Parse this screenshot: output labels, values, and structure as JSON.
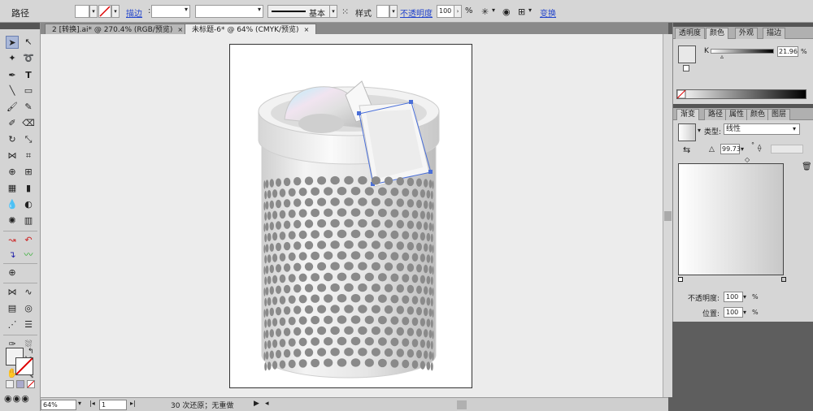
{
  "control_bar": {
    "selection_label": "路径",
    "stroke_label": "描边",
    "stroke_profile": "基本",
    "style_label": "样式",
    "opacity_label": "不透明度",
    "opacity_value": "100",
    "opacity_unit": "%",
    "transform_label": "变换"
  },
  "doc_tabs": [
    {
      "label": "2 [转换].ai* @ 270.4% (RGB/预览)",
      "close": "×"
    },
    {
      "label": "未标题-6* @ 64% (CMYK/预览)",
      "close": "×"
    }
  ],
  "status_bar": {
    "zoom": "64%",
    "page": "1",
    "history": "30 次还原；无重做"
  },
  "color_panel": {
    "tabs": [
      "透明度",
      "颜色",
      "外观",
      "描边"
    ],
    "active_tab": "颜色",
    "channel_label": "K",
    "channel_value": "21.96",
    "channel_unit": "%"
  },
  "gradient_panel": {
    "tabs": [
      "渐变",
      "路径",
      "属性",
      "颜色",
      "图层"
    ],
    "active_tab": "渐变",
    "type_label": "类型:",
    "type_value": "线性",
    "angle_value": "99.73",
    "angle_unit": "°",
    "opacity_label": "不透明度:",
    "opacity_value": "100",
    "opacity_unit": "%",
    "location_label": "位置:",
    "location_value": "100",
    "location_unit": "%"
  },
  "icons": {
    "selection": "arrow-icon",
    "trash": "trash-icon",
    "eye": "eye-icon"
  },
  "colors": {
    "link": "#2244cc",
    "selection_path": "#4a6fd8",
    "hole": "#8a8a8a"
  }
}
